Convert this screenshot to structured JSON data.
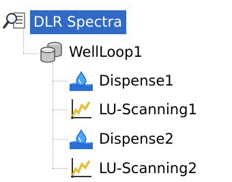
{
  "tree": {
    "root": {
      "label": "DLR Spectra",
      "icon": "search-settings-icon",
      "selected": true
    },
    "group": {
      "label": "WellLoop1",
      "icon": "database-cylinders-icon"
    },
    "items": [
      {
        "label": "Dispense1",
        "icon": "dispense-droplet-icon"
      },
      {
        "label": "LU-Scanning1",
        "icon": "scanning-chart-icon"
      },
      {
        "label": "Dispense2",
        "icon": "dispense-droplet-icon"
      },
      {
        "label": "LU-Scanning2",
        "icon": "scanning-chart-icon"
      }
    ]
  }
}
